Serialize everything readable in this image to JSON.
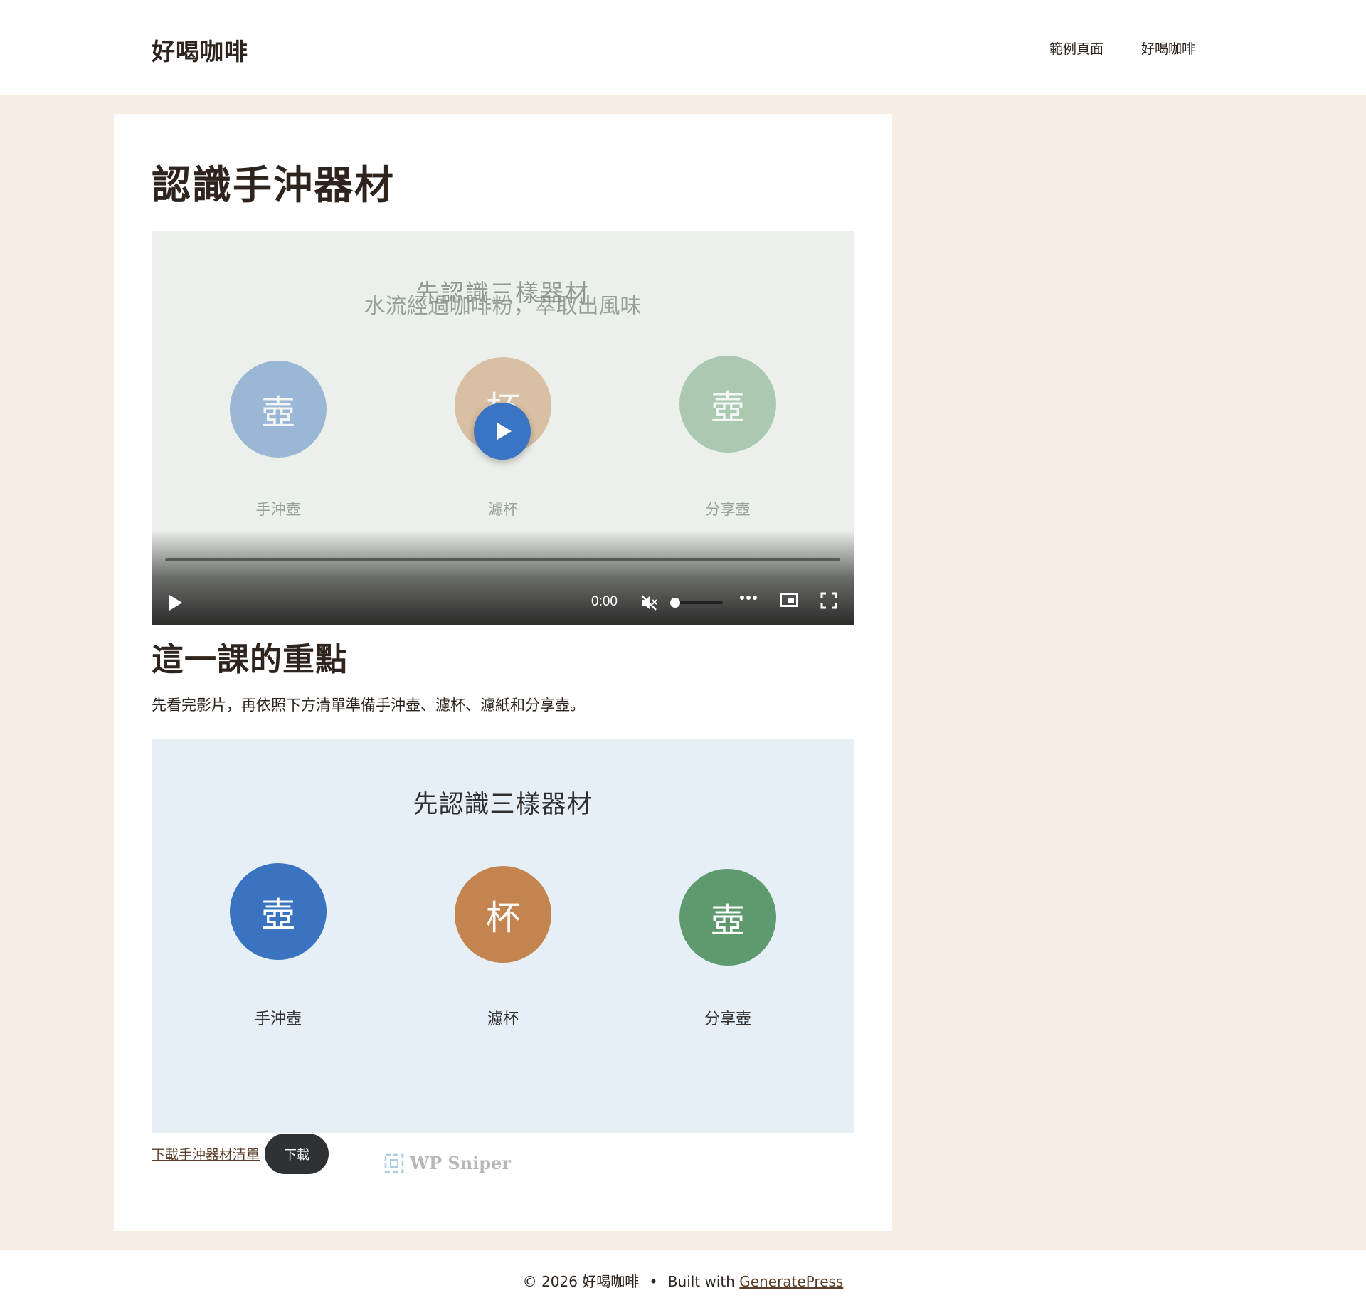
{
  "header": {
    "site_title": "好喝咖啡",
    "nav": [
      "範例頁面",
      "好喝咖啡"
    ]
  },
  "article": {
    "title": "認識手沖器材",
    "video": {
      "overlay_title": "先認識三樣器材",
      "overlay_subtitle": "水流經過咖啡粉，萃取出風味",
      "items": [
        {
          "glyph": "壺",
          "label": "手沖壺",
          "color": "#3a74c0"
        },
        {
          "glyph": "杯",
          "label": "濾杯",
          "color": "#c4844f"
        },
        {
          "glyph": "壺",
          "label": "分享壺",
          "color": "#5e9a6e"
        }
      ],
      "time": "0:00",
      "muted": true
    },
    "section_title": "這一課的重點",
    "paragraph": "先看完影片，再依照下方清單準備手沖壺、濾杯、濾紙和分享壺。",
    "illustration": {
      "title": "先認識三樣器材",
      "items": [
        {
          "glyph": "壺",
          "label": "手沖壺",
          "color": "#3a74c0"
        },
        {
          "glyph": "杯",
          "label": "濾杯",
          "color": "#c4844f"
        },
        {
          "glyph": "壺",
          "label": "分享壺",
          "color": "#5e9a6e"
        }
      ]
    },
    "download_link": "下載手沖器材清單",
    "download_button": "下載",
    "badge": "WP Sniper"
  },
  "footer": {
    "copyright": "© 2026 好喝咖啡",
    "separator": "•",
    "built_with": "Built with",
    "theme_link": "GeneratePress"
  },
  "colors": {
    "page_bg": "#f6eee5",
    "accent_play": "#3a75c4"
  }
}
